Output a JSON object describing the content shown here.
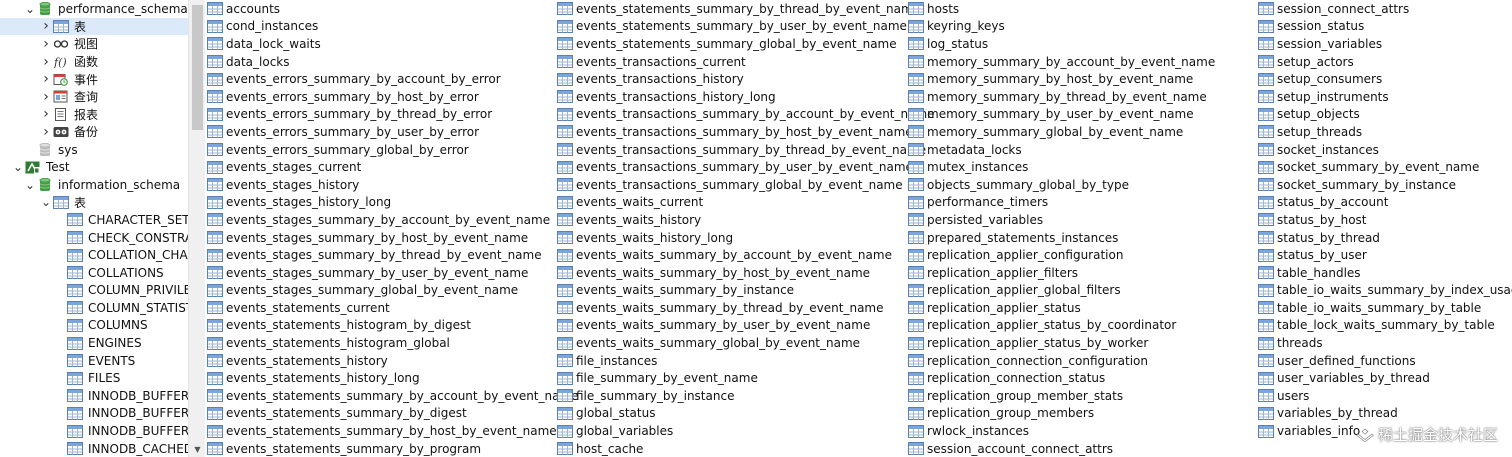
{
  "navigator": {
    "rows": [
      {
        "level": 1,
        "expander": "down",
        "icon": "database-icon",
        "label": "performance_schema",
        "selected": false
      },
      {
        "level": 2,
        "expander": "right",
        "icon": "table-icon",
        "label": "表",
        "selected": true
      },
      {
        "level": 2,
        "expander": "right",
        "icon": "view-icon",
        "label": "视图",
        "selected": false
      },
      {
        "level": 2,
        "expander": "right",
        "icon": "function-icon",
        "label": "函数",
        "selected": false
      },
      {
        "level": 2,
        "expander": "right",
        "icon": "event-icon",
        "label": "事件",
        "selected": false
      },
      {
        "level": 2,
        "expander": "right",
        "icon": "query-icon",
        "label": "查询",
        "selected": false
      },
      {
        "level": 2,
        "expander": "right",
        "icon": "report-icon",
        "label": "报表",
        "selected": false
      },
      {
        "level": 2,
        "expander": "right",
        "icon": "backup-icon",
        "label": "备份",
        "selected": false
      },
      {
        "level": 1,
        "expander": "none",
        "icon": "database-gray-icon",
        "label": "sys",
        "selected": false
      },
      {
        "level": 0,
        "expander": "down",
        "icon": "connection-icon",
        "label": "Test",
        "selected": false
      },
      {
        "level": 1,
        "expander": "down",
        "icon": "database-icon",
        "label": "information_schema",
        "selected": false
      },
      {
        "level": 2,
        "expander": "down",
        "icon": "table-icon",
        "label": "表",
        "selected": false
      },
      {
        "level": 3,
        "expander": "none",
        "icon": "table-icon",
        "label": "CHARACTER_SETS",
        "selected": false
      },
      {
        "level": 3,
        "expander": "none",
        "icon": "table-icon",
        "label": "CHECK_CONSTRA",
        "selected": false
      },
      {
        "level": 3,
        "expander": "none",
        "icon": "table-icon",
        "label": "COLLATION_CHAI",
        "selected": false
      },
      {
        "level": 3,
        "expander": "none",
        "icon": "table-icon",
        "label": "COLLATIONS",
        "selected": false
      },
      {
        "level": 3,
        "expander": "none",
        "icon": "table-icon",
        "label": "COLUMN_PRIVILE",
        "selected": false
      },
      {
        "level": 3,
        "expander": "none",
        "icon": "table-icon",
        "label": "COLUMN_STATIST",
        "selected": false
      },
      {
        "level": 3,
        "expander": "none",
        "icon": "table-icon",
        "label": "COLUMNS",
        "selected": false
      },
      {
        "level": 3,
        "expander": "none",
        "icon": "table-icon",
        "label": "ENGINES",
        "selected": false
      },
      {
        "level": 3,
        "expander": "none",
        "icon": "table-icon",
        "label": "EVENTS",
        "selected": false
      },
      {
        "level": 3,
        "expander": "none",
        "icon": "table-icon",
        "label": "FILES",
        "selected": false
      },
      {
        "level": 3,
        "expander": "none",
        "icon": "table-icon",
        "label": "INNODB_BUFFER_",
        "selected": false
      },
      {
        "level": 3,
        "expander": "none",
        "icon": "table-icon",
        "label": "INNODB_BUFFER_",
        "selected": false
      },
      {
        "level": 3,
        "expander": "none",
        "icon": "table-icon",
        "label": "INNODB_BUFFER_",
        "selected": false
      },
      {
        "level": 3,
        "expander": "none",
        "icon": "table-icon",
        "label": "INNODB_CACHED",
        "selected": false
      }
    ]
  },
  "tables": {
    "columns": [
      [
        "accounts",
        "cond_instances",
        "data_lock_waits",
        "data_locks",
        "events_errors_summary_by_account_by_error",
        "events_errors_summary_by_host_by_error",
        "events_errors_summary_by_thread_by_error",
        "events_errors_summary_by_user_by_error",
        "events_errors_summary_global_by_error",
        "events_stages_current",
        "events_stages_history",
        "events_stages_history_long",
        "events_stages_summary_by_account_by_event_name",
        "events_stages_summary_by_host_by_event_name",
        "events_stages_summary_by_thread_by_event_name",
        "events_stages_summary_by_user_by_event_name",
        "events_stages_summary_global_by_event_name",
        "events_statements_current",
        "events_statements_histogram_by_digest",
        "events_statements_histogram_global",
        "events_statements_history",
        "events_statements_history_long",
        "events_statements_summary_by_account_by_event_name",
        "events_statements_summary_by_digest",
        "events_statements_summary_by_host_by_event_name",
        "events_statements_summary_by_program"
      ],
      [
        "events_statements_summary_by_thread_by_event_name",
        "events_statements_summary_by_user_by_event_name",
        "events_statements_summary_global_by_event_name",
        "events_transactions_current",
        "events_transactions_history",
        "events_transactions_history_long",
        "events_transactions_summary_by_account_by_event_name",
        "events_transactions_summary_by_host_by_event_name",
        "events_transactions_summary_by_thread_by_event_name",
        "events_transactions_summary_by_user_by_event_name",
        "events_transactions_summary_global_by_event_name",
        "events_waits_current",
        "events_waits_history",
        "events_waits_history_long",
        "events_waits_summary_by_account_by_event_name",
        "events_waits_summary_by_host_by_event_name",
        "events_waits_summary_by_instance",
        "events_waits_summary_by_thread_by_event_name",
        "events_waits_summary_by_user_by_event_name",
        "events_waits_summary_global_by_event_name",
        "file_instances",
        "file_summary_by_event_name",
        "file_summary_by_instance",
        "global_status",
        "global_variables",
        "host_cache"
      ],
      [
        "hosts",
        "keyring_keys",
        "log_status",
        "memory_summary_by_account_by_event_name",
        "memory_summary_by_host_by_event_name",
        "memory_summary_by_thread_by_event_name",
        "memory_summary_by_user_by_event_name",
        "memory_summary_global_by_event_name",
        "metadata_locks",
        "mutex_instances",
        "objects_summary_global_by_type",
        "performance_timers",
        "persisted_variables",
        "prepared_statements_instances",
        "replication_applier_configuration",
        "replication_applier_filters",
        "replication_applier_global_filters",
        "replication_applier_status",
        "replication_applier_status_by_coordinator",
        "replication_applier_status_by_worker",
        "replication_connection_configuration",
        "replication_connection_status",
        "replication_group_member_stats",
        "replication_group_members",
        "rwlock_instances",
        "session_account_connect_attrs"
      ],
      [
        "session_connect_attrs",
        "session_status",
        "session_variables",
        "setup_actors",
        "setup_consumers",
        "setup_instruments",
        "setup_objects",
        "setup_threads",
        "socket_instances",
        "socket_summary_by_event_name",
        "socket_summary_by_instance",
        "status_by_account",
        "status_by_host",
        "status_by_thread",
        "status_by_user",
        "table_handles",
        "table_io_waits_summary_by_index_usage",
        "table_io_waits_summary_by_table",
        "table_lock_waits_summary_by_table",
        "threads",
        "user_defined_functions",
        "user_variables_by_thread",
        "users",
        "variables_by_thread",
        "variables_info"
      ]
    ]
  },
  "watermark": {
    "text": "稀土掘金技术社区"
  },
  "colors": {
    "selection": "#dce9f8",
    "table_icon_header": "#6f9fd6",
    "database_green": "#4caf50"
  }
}
